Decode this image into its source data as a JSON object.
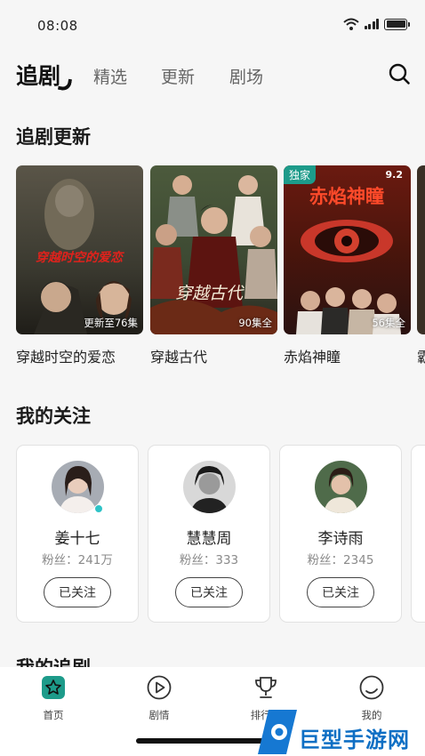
{
  "status_bar": {
    "time": "08:08"
  },
  "top_nav": {
    "tabs": [
      {
        "label": "追剧",
        "active": true
      },
      {
        "label": "精选",
        "active": false
      },
      {
        "label": "更新",
        "active": false
      },
      {
        "label": "剧场",
        "active": false
      }
    ]
  },
  "section_updates": {
    "title": "追剧更新",
    "dramas": [
      {
        "name": "穿越时空的爱恋",
        "cover_title": "穿越时空的爱恋",
        "episode_text": "更新至76集"
      },
      {
        "name": "穿越古代",
        "cover_title": "穿越古代",
        "episode_text": "90集全"
      },
      {
        "name": "赤焰神瞳",
        "cover_title": "赤焰神瞳",
        "episode_text": "56集全",
        "tag": "独家",
        "date": "9.2"
      },
      {
        "name": "霸"
      }
    ]
  },
  "section_follows": {
    "title": "我的关注",
    "people": [
      {
        "name": "姜十七",
        "fans": "粉丝：241万",
        "button": "已关注"
      },
      {
        "name": "慧慧周",
        "fans": "粉丝：333",
        "button": "已关注"
      },
      {
        "name": "李诗雨",
        "fans": "粉丝：2345",
        "button": "已关注"
      }
    ]
  },
  "section_mine": {
    "title": "我的追剧"
  },
  "bottom_nav": {
    "items": [
      {
        "label": "首页",
        "icon": "home-star-icon",
        "active": true
      },
      {
        "label": "剧情",
        "icon": "play-circle-icon",
        "active": false
      },
      {
        "label": "排行榜",
        "icon": "trophy-icon",
        "active": false
      },
      {
        "label": "我的",
        "icon": "profile-circle-icon",
        "active": false
      }
    ]
  },
  "watermark": {
    "text": "巨型手游网"
  },
  "colors": {
    "accent": "#1d9b8a",
    "online": "#2fc3c7",
    "watermark": "#0f6fc4"
  }
}
